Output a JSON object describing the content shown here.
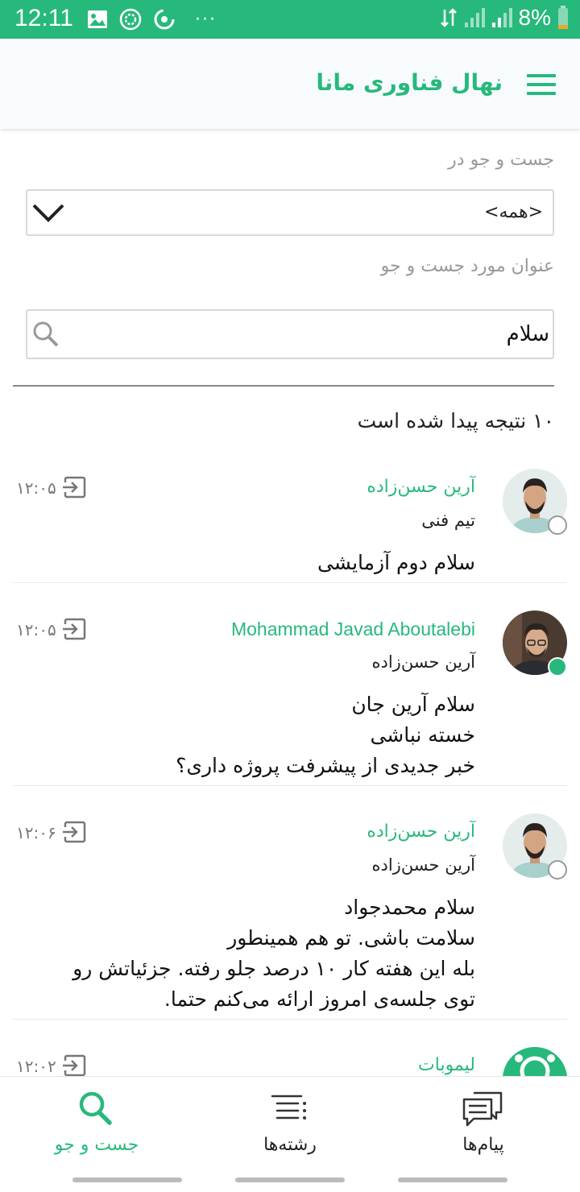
{
  "statusbar": {
    "time": "12:11",
    "battery": "8%",
    "more": "···"
  },
  "appbar": {
    "title": "نهال فناوری مانا"
  },
  "filter": {
    "scope_label": "جست و جو در",
    "scope_value": "<همه>",
    "query_label": "عنوان مورد جست و جو",
    "query_value": "سلام"
  },
  "results": {
    "count_text": "۱۰ نتیجه پیدا شده است",
    "items": [
      {
        "sender": "آرین حسن‌زاده",
        "sub": "تیم فنی",
        "time": "۱۲:۰۵",
        "lines": [
          "سلام دوم آزمایشی"
        ],
        "online": false
      },
      {
        "sender": "Mohammad Javad Aboutalebi",
        "sub": "آرین حسن‌زاده",
        "time": "۱۲:۰۵",
        "lines": [
          "سلام آرین جان",
          "خسته نباشی",
          "خبر جدیدی از پیشرفت پروژه داری؟"
        ],
        "online": true
      },
      {
        "sender": "آرین حسن‌زاده",
        "sub": "آرین حسن‌زاده",
        "time": "۱۲:۰۶",
        "lines": [
          "سلام محمدجواد",
          "سلامت باشی. تو هم همینطور",
          "بله این هفته کار ۱۰ درصد جلو رفته. جزئیاتش رو",
          "توی جلسه‌ی امروز ارائه می‌کنم حتما."
        ],
        "online": false
      },
      {
        "sender": "لیموبات",
        "time": "۱۲:۰۲"
      }
    ]
  },
  "bottomnav": {
    "search": "جست و جو",
    "threads": "رشته‌ها",
    "messages": "پیام‌ها"
  },
  "colors": {
    "accent": "#27b97c"
  }
}
